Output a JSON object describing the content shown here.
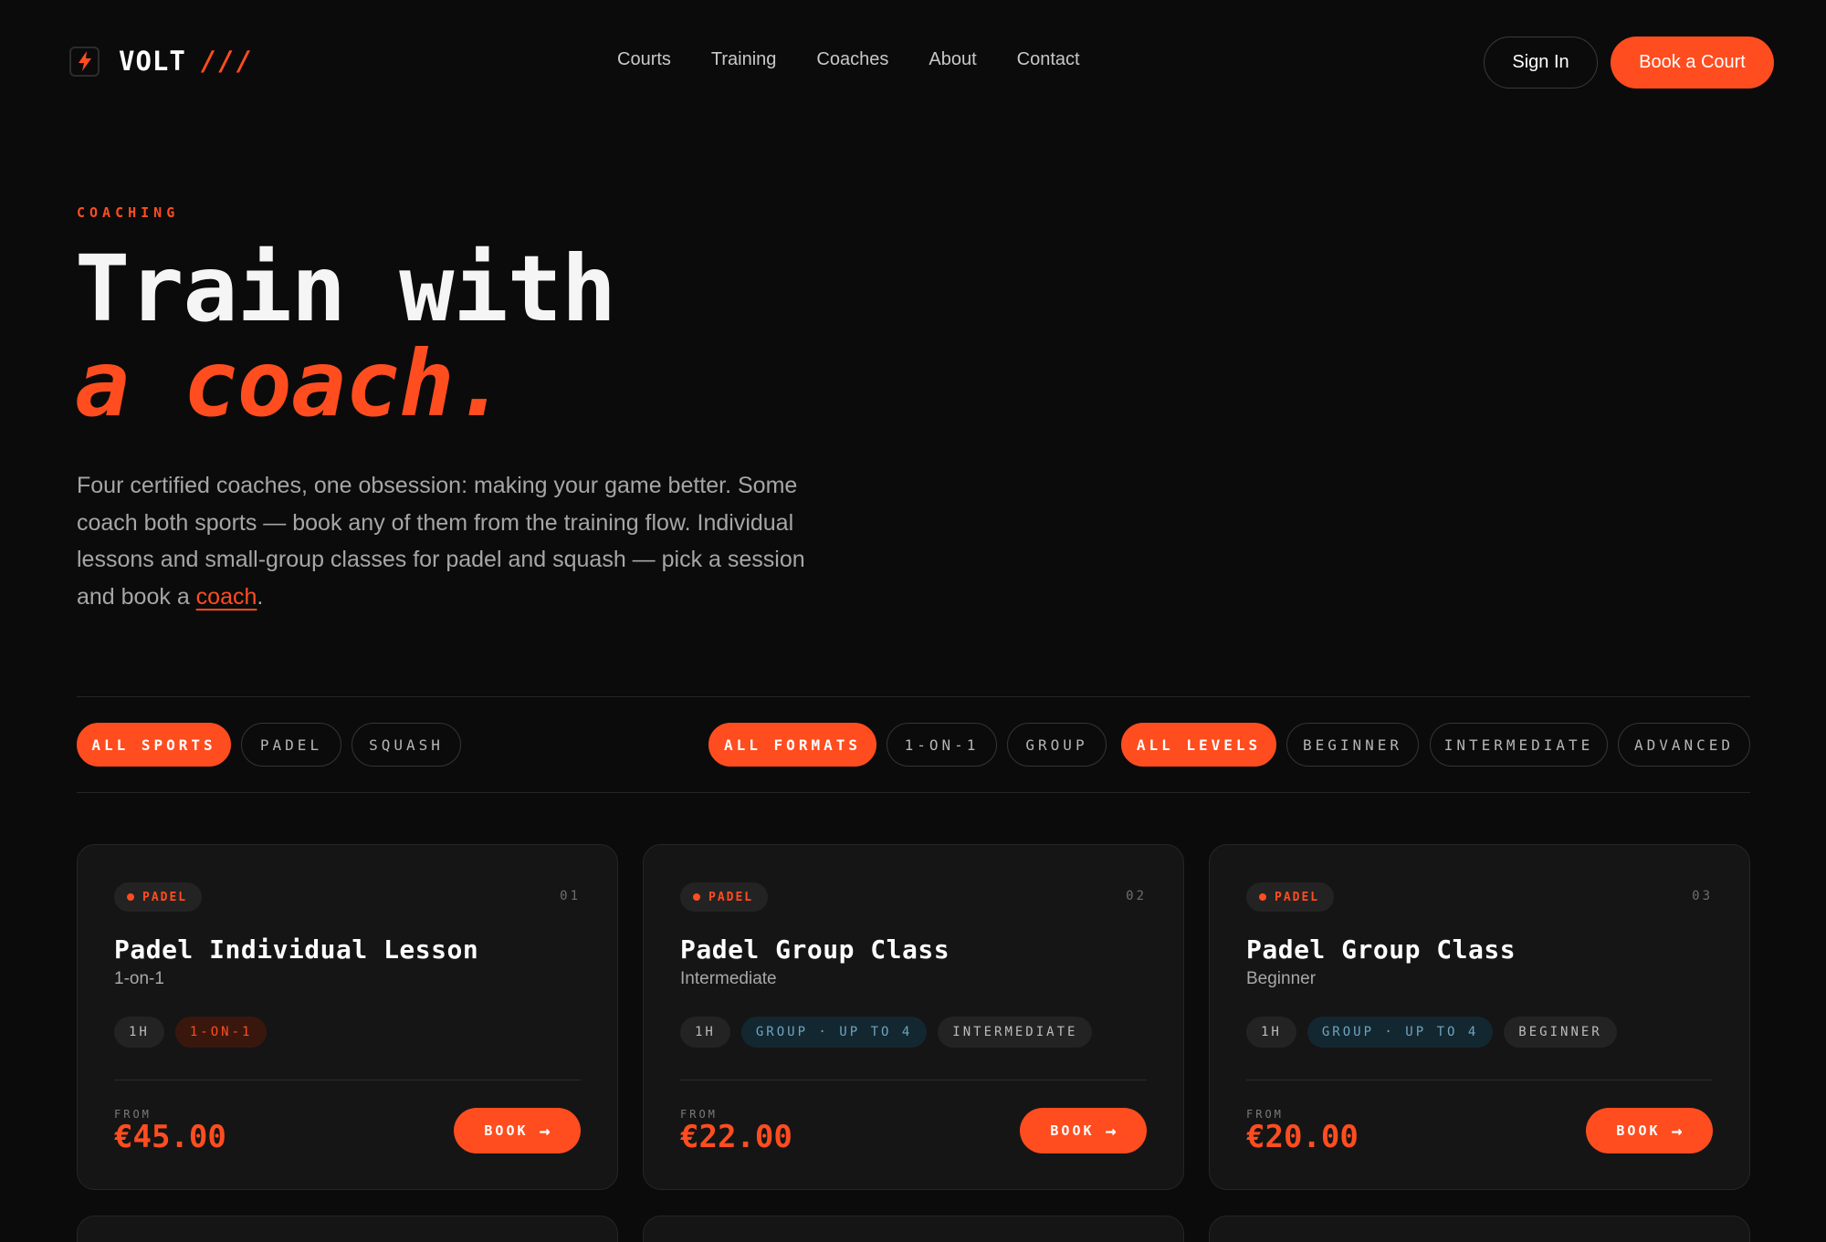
{
  "header": {
    "brand": "VOLT",
    "brand_mark": "///",
    "logo_icon": "lightning-bolt-icon",
    "nav": [
      "Courts",
      "Training",
      "Coaches",
      "About",
      "Contact"
    ],
    "sign_in": "Sign In",
    "book_court": "Book a Court"
  },
  "hero": {
    "eyebrow": "COACHING",
    "title_line1": "Train with",
    "title_line2": "a coach.",
    "desc_lead": "Four certified coaches, one obsession: making your game better. Some coach both sports — book any of them from the training flow. Individual lessons and small-group classes for padel and squash — pick a session and book a ",
    "desc_link": "coach",
    "desc_end": "."
  },
  "filters": {
    "sports": [
      "ALL SPORTS",
      "PADEL",
      "SQUASH"
    ],
    "formats": [
      "ALL FORMATS",
      "1-ON-1",
      "GROUP"
    ],
    "levels": [
      "ALL LEVELS",
      "BEGINNER",
      "INTERMEDIATE",
      "ADVANCED"
    ]
  },
  "cards": [
    {
      "sport": "PADEL",
      "number": "01",
      "title": "Padel Individual Lesson",
      "subtitle": "1-on-1",
      "tags": [
        "1H",
        "1-ON-1"
      ],
      "from_label": "FROM",
      "price": "€45.00",
      "button": "BOOK",
      "arrow": "→"
    },
    {
      "sport": "PADEL",
      "number": "02",
      "title": "Padel Group Class",
      "subtitle": "Intermediate",
      "tags": [
        "1H",
        "GROUP · UP TO 4",
        "INTERMEDIATE"
      ],
      "from_label": "FROM",
      "price": "€22.00",
      "button": "BOOK",
      "arrow": "→"
    },
    {
      "sport": "PADEL",
      "number": "03",
      "title": "Padel Group Class",
      "subtitle": "Beginner",
      "tags": [
        "1H",
        "GROUP · UP TO 4",
        "BEGINNER"
      ],
      "from_label": "FROM",
      "price": "€20.00",
      "button": "BOOK",
      "arrow": "→"
    }
  ],
  "colors": {
    "background": "#0b0b0b",
    "accent": "#ff4d1f",
    "card": "#151515"
  }
}
